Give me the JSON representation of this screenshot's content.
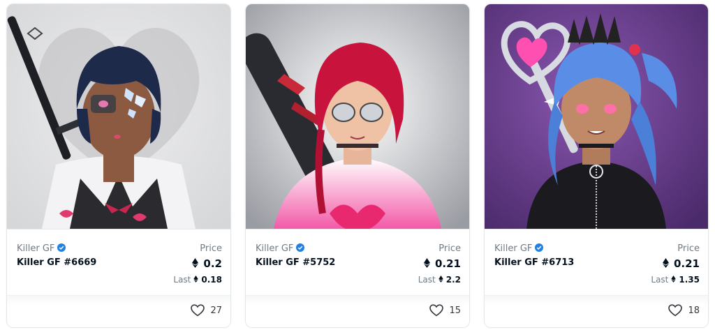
{
  "cards": [
    {
      "collection": "Killer GF",
      "verified_icon": "verified-badge-icon",
      "name": "Killer GF #6669",
      "price_label": "Price",
      "price": "0.2",
      "last_label": "Last",
      "last_price": "0.18",
      "likes": "27",
      "currency_icon": "eth-icon",
      "like_icon": "heart-icon"
    },
    {
      "collection": "Killer GF",
      "verified_icon": "verified-badge-icon",
      "name": "Killer GF #5752",
      "price_label": "Price",
      "price": "0.21",
      "last_label": "Last",
      "last_price": "2.2",
      "likes": "15",
      "currency_icon": "eth-icon",
      "like_icon": "heart-icon"
    },
    {
      "collection": "Killer GF",
      "verified_icon": "verified-badge-icon",
      "name": "Killer GF #6713",
      "price_label": "Price",
      "price": "0.21",
      "last_label": "Last",
      "last_price": "1.35",
      "likes": "18",
      "currency_icon": "eth-icon",
      "like_icon": "heart-icon"
    }
  ],
  "colors": {
    "verified_blue": "#2081e2",
    "text_dark": "#04111d",
    "text_muted": "#707a83",
    "border": "#e5e8eb"
  }
}
